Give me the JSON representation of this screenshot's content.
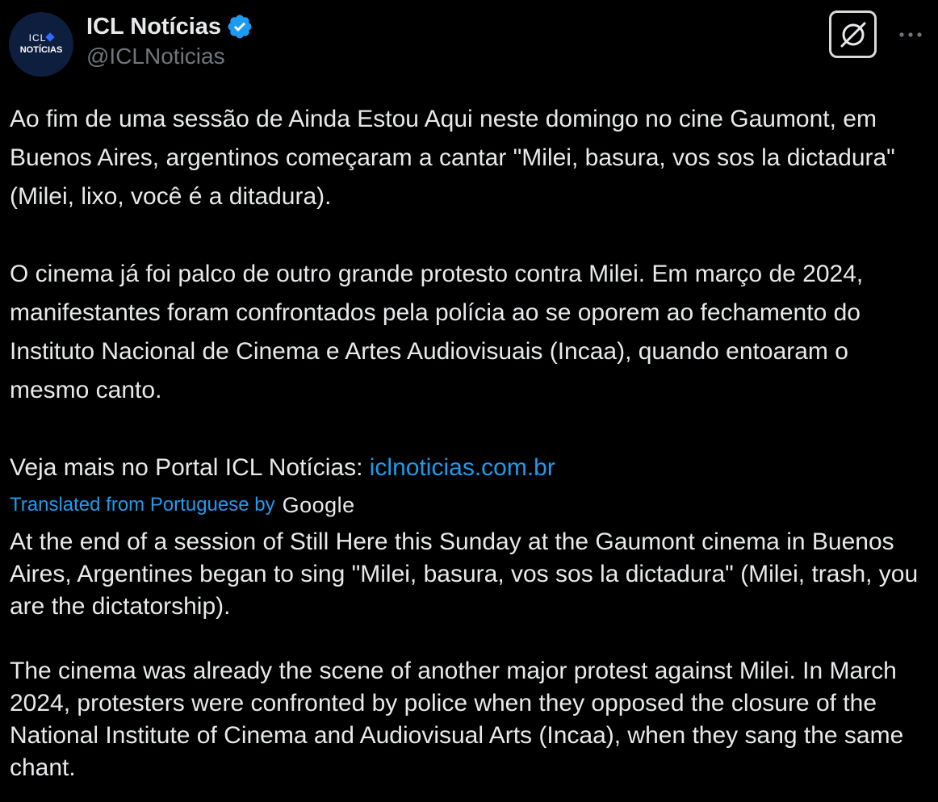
{
  "account": {
    "avatar_text_top": "ICL",
    "avatar_text_bottom": "NOTÍCIAS",
    "display_name": "ICL Notícias",
    "handle": "@ICLNoticias",
    "verified_icon": "verified-badge-icon",
    "verified_color": "#1d9bf0"
  },
  "actions": {
    "grok_icon": "grok-icon",
    "more_icon": "more-dots-icon"
  },
  "tweet": {
    "paragraphs": [
      "Ao fim de uma sessão de Ainda Estou Aqui neste domingo no cine Gaumont, em Buenos Aires, argentinos começaram a cantar \"Milei, basura, vos sos la dictadura\" (Milei, lixo, você é a ditadura).",
      "O cinema já foi palco de outro grande protesto contra Milei. Em março de 2024, manifestantes foram confrontados pela polícia ao se oporem ao fechamento do Instituto Nacional de Cinema e Artes Audiovisuais (Incaa), quando entoaram o mesmo canto."
    ],
    "link_prefix": "Veja mais no Portal ICL Notícias: ",
    "link_text": "iclnoticias.com.br",
    "link_color": "#1d9bf0"
  },
  "translation": {
    "label": "Translated from Portuguese by",
    "provider": "Google",
    "paragraphs": [
      "At the end of a session of Still Here this Sunday at the Gaumont cinema in Buenos Aires, Argentines began to sing \"Milei, basura, vos sos la dictadura\" (Milei, trash, you are the dictatorship).",
      "The cinema was already the scene of another major protest against Milei. In March 2024, protesters were confronted by police when they opposed the closure of the National Institute of Cinema and Audiovisual Arts (Incaa), when they sang the same chant."
    ]
  }
}
